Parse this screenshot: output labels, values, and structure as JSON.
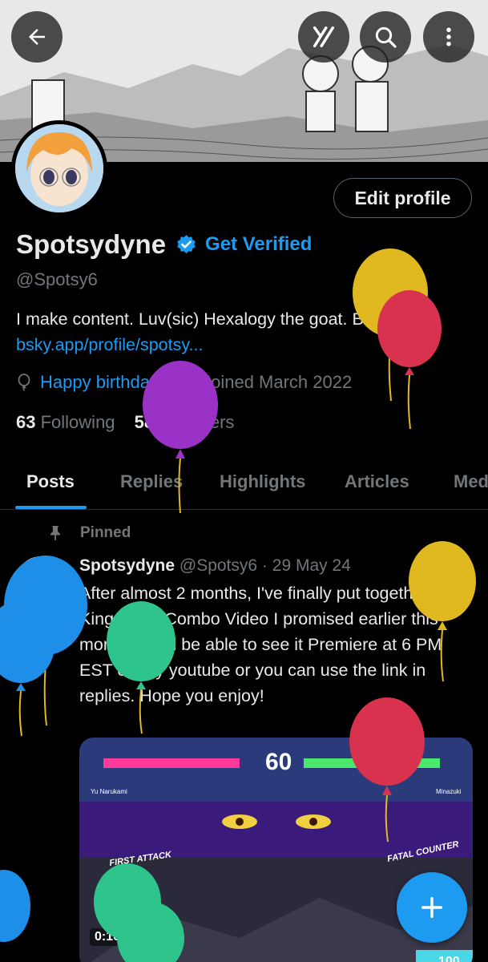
{
  "profile": {
    "display_name": "Spotsydyne",
    "get_verified_label": "Get Verified",
    "handle": "@Spotsy6",
    "edit_profile_label": "Edit profile",
    "bio_text": "I make content. Luv(sic) Hexalogy the goat. Bluesky:",
    "bio_link": "bsky.app/profile/spotsy...",
    "birthday_label": "Happy birthday!",
    "joined_label": "Joined March 2022",
    "following_count": "63",
    "following_label": "Following",
    "followers_count": "58",
    "followers_label": "Followers"
  },
  "tabs": [
    {
      "label": "Posts",
      "active": true
    },
    {
      "label": "Replies",
      "active": false
    },
    {
      "label": "Highlights",
      "active": false
    },
    {
      "label": "Articles",
      "active": false
    },
    {
      "label": "Media",
      "active": false
    }
  ],
  "pinned_post": {
    "pinned_label": "Pinned",
    "author_name": "Spotsydyne",
    "author_handle": "@Spotsy6",
    "separator": "·",
    "date": "29 May 24",
    "text": "After almost 2 months, I've finally put together the Kingslayer Combo Video I promised earlier this month. You'll be able to see it Premiere at 6 PM EST on my youtube or you can use the link in replies. Hope you enjoy!",
    "media_time": "0:10",
    "media_overlay": {
      "combo_count": "60",
      "attack_left": "FIRST ATTACK",
      "attack_right": "FATAL COUNTER",
      "character_left": "Yu Narukami",
      "character_right": "Minazuki",
      "score": "100"
    }
  },
  "icons": {
    "back": "back-arrow-icon",
    "grok": "grok-icon",
    "search": "search-icon",
    "more": "more-vertical-icon",
    "verified": "verified-badge-icon",
    "birthday": "balloon-icon",
    "calendar": "calendar-icon",
    "pin": "pin-icon",
    "compose": "plus-icon"
  },
  "colors": {
    "accent": "#1d9bf0",
    "secondary_text": "#71767b",
    "primary_text": "#e7e9ea",
    "background": "#000000",
    "balloon_yellow": "#e0b820",
    "balloon_red": "#d8324e",
    "balloon_purple": "#9b32c8",
    "balloon_blue": "#1d8fe8",
    "balloon_green": "#2fc48c"
  }
}
